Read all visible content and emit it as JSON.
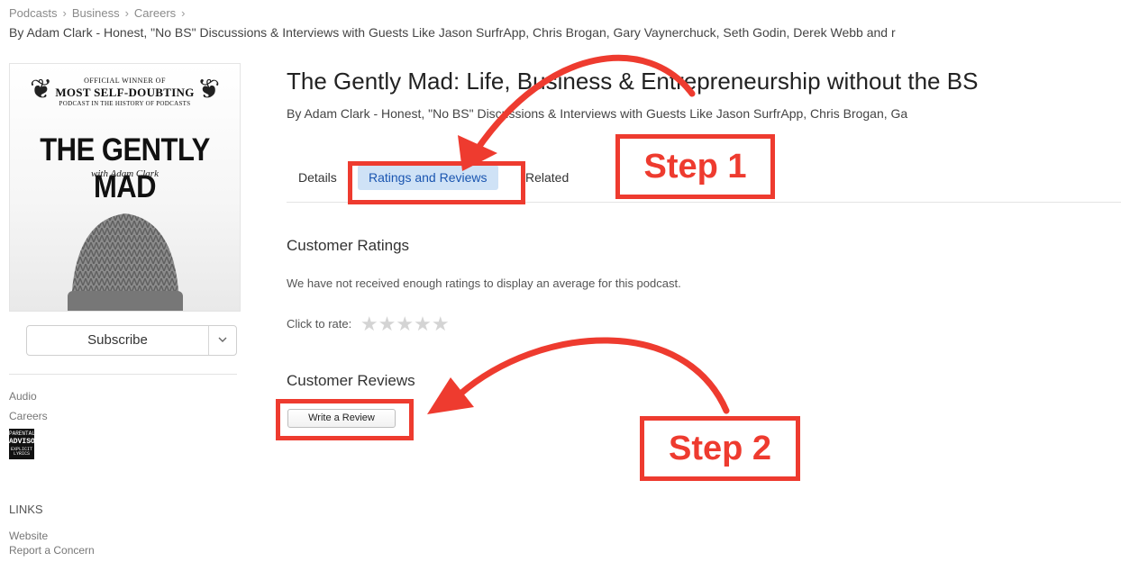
{
  "breadcrumb": [
    "Podcasts",
    "Business",
    "Careers"
  ],
  "breadcrumb_sep": "›",
  "byline_top": "By Adam Clark - Honest, \"No BS\" Discussions & Interviews with Guests Like Jason SurfrApp, Chris Brogan, Gary Vaynerchuck, Seth Godin, Derek Webb and r",
  "artwork": {
    "award_line1": "OFFICIAL WINNER OF",
    "award_line2": "MOST SELF-DOUBTING",
    "award_line3": "PODCAST IN THE HISTORY OF PODCASTS",
    "title": "THE GENTLY MAD",
    "subtitle": "with Adam Clark"
  },
  "sidebar": {
    "subscribe_label": "Subscribe",
    "category_type": "Audio",
    "category": "Careers",
    "advisory": {
      "line1": "PARENTAL",
      "line2": "ADVISORY",
      "line3": "EXPLICIT LYRICS"
    },
    "links_heading": "LINKS",
    "links": [
      "Website",
      "Report a Concern"
    ]
  },
  "podcast": {
    "title": "The Gently Mad: Life, Business & Entrepreneurship without the BS",
    "byline": "By Adam Clark - Honest, \"No BS\" Discussions & Interviews with Guests Like Jason SurfrApp, Chris Brogan, Ga"
  },
  "tabs": [
    {
      "label": "Details",
      "selected": false
    },
    {
      "label": "Ratings and Reviews",
      "selected": true
    },
    {
      "label": "Related",
      "selected": false
    }
  ],
  "ratings": {
    "heading": "Customer Ratings",
    "note": "We have not received enough ratings to display an average for this podcast.",
    "click_to_rate": "Click to rate:",
    "stars": 5
  },
  "reviews": {
    "heading": "Customer Reviews",
    "write_button": "Write a Review"
  },
  "annotations": {
    "step1": "Step 1",
    "step2": "Step 2",
    "color": "#ee3b2f"
  }
}
